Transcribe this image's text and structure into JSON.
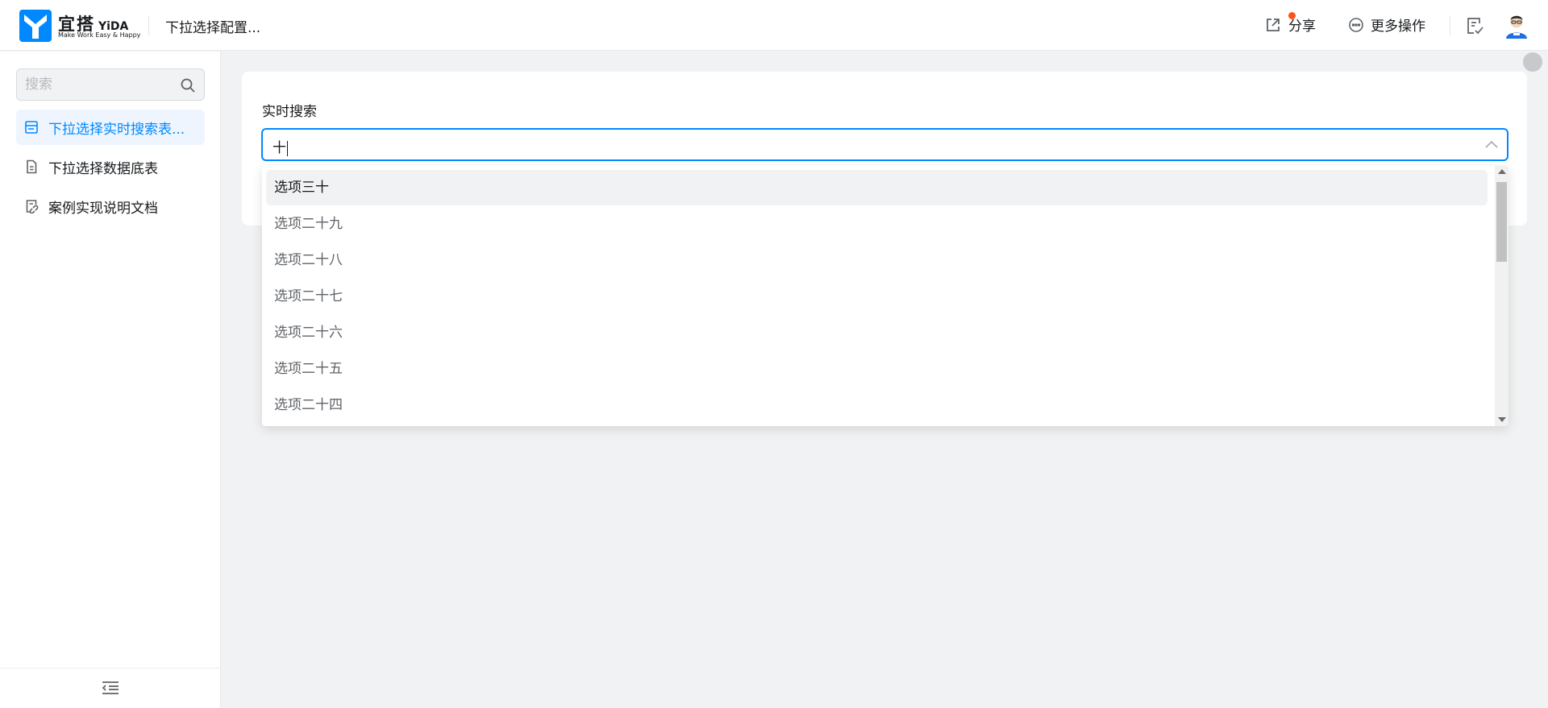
{
  "header": {
    "logo_cn": "宜搭",
    "logo_en": "YiDA",
    "logo_slogan": "Make Work Easy & Happy",
    "app_title": "下拉选择配置...",
    "share_label": "分享",
    "more_label": "更多操作"
  },
  "sidebar": {
    "search_placeholder": "搜索",
    "items": [
      {
        "label": "下拉选择实时搜索表...",
        "icon": "form-icon",
        "active": true
      },
      {
        "label": "下拉选择数据底表",
        "icon": "doc-icon",
        "active": false
      },
      {
        "label": "案例实现说明文档",
        "icon": "link-doc-icon",
        "active": false
      }
    ]
  },
  "form": {
    "field_label": "实时搜索",
    "search_value": "十"
  },
  "dropdown": {
    "options": [
      "选项三十",
      "选项二十九",
      "选项二十八",
      "选项二十七",
      "选项二十六",
      "选项二十五",
      "选项二十四"
    ],
    "hovered_index": 0
  },
  "colors": {
    "accent": "#0089ff",
    "active_bg": "#eef5ff",
    "notification": "#ff5219"
  }
}
